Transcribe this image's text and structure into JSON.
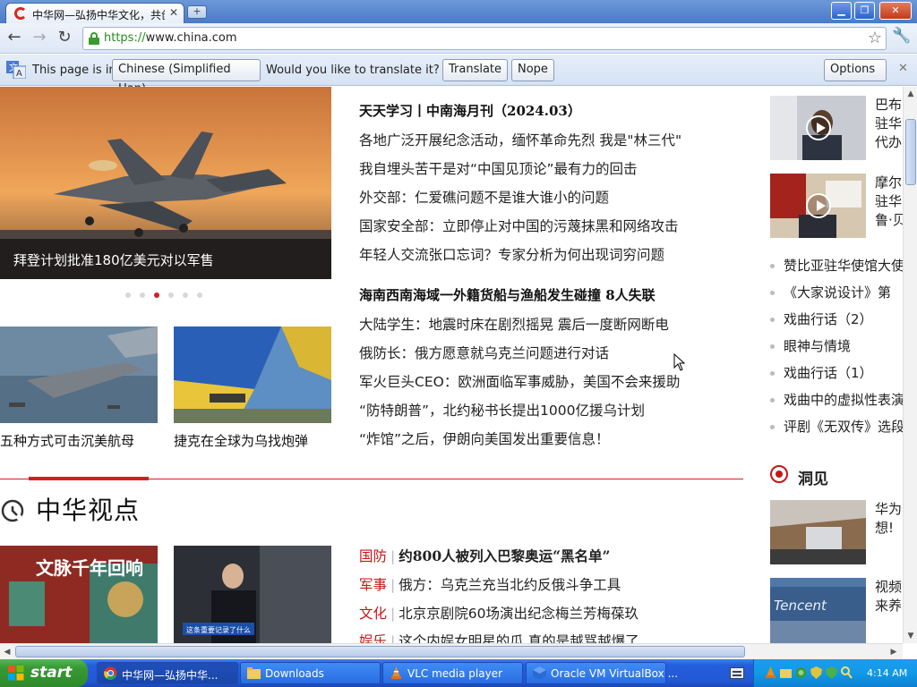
{
  "browser": {
    "tab_title": "中华网—弘扬中华文化，共创",
    "tab_close": "✕",
    "new_tab": "+",
    "url_scheme": "https://",
    "url_host": "www.china.com",
    "window_controls": {
      "minimize": "▁",
      "maximize": "❐",
      "close": "✕"
    }
  },
  "translate_bar": {
    "prefix": "This page is in",
    "language": "Chinese (Simplified Han)",
    "question": "Would you like to translate it?",
    "translate_label": "Translate",
    "nope_label": "Nope",
    "options_label": "Options",
    "close": "✕"
  },
  "page": {
    "hero": {
      "caption": "拜登计划批准180亿美元对以军售",
      "slide_count": 6,
      "active_slide": 3
    },
    "thumbs": [
      {
        "caption": "五种方式可击沉美航母"
      },
      {
        "caption": "捷克在全球为乌找炮弹"
      }
    ],
    "news_group1": {
      "headline": "天天学习丨中南海月刊（2024.03）",
      "items": [
        "各地广泛开展纪念活动，缅怀革命先烈 我是\"林三代\"",
        "我自埋头苦干是对“中国见顶论”最有力的回击",
        "外交部：仁爱礁问题不是谁大谁小的问题",
        "国家安全部：立即停止对中国的污蔑抹黑和网络攻击",
        "年轻人交流张口忘词？专家分析为何出现词穷问题"
      ]
    },
    "news_group2": {
      "headline": "海南西南海域一外籍货船与渔船发生碰撞 8人失联",
      "items": [
        "大陆学生：地震时床在剧烈摇晃 震后一度断网断电",
        "俄防长：俄方愿意就乌克兰问题进行对话",
        "军火巨头CEO：欧洲面临军事威胁，美国不会来援助",
        "“防特朗普”，北约秘书长提出1000亿援乌计划",
        "“炸馆”之后，伊朗向美国发出重要信息！"
      ]
    },
    "section": {
      "title": "中华视点",
      "items": [
        {
          "category": "国防",
          "text": "约800人被列入巴黎奥运“黑名单”",
          "bold": true
        },
        {
          "category": "军事",
          "text": "俄方：乌克兰充当北约反俄斗争工具",
          "bold": false
        },
        {
          "category": "文化",
          "text": "北京京剧院60场演出纪念梅兰芳梅葆玖",
          "bold": false
        },
        {
          "category": "娱乐",
          "text": "这个内娱女明星的瓜 真的是越骂越爆了",
          "bold": false
        }
      ],
      "thumb1_text": "文脉千年回响",
      "thumb2_badge": "这条重要记录了什么"
    },
    "right": {
      "videos": [
        {
          "lines": [
            "巴布",
            "驻华",
            "代办"
          ]
        },
        {
          "lines": [
            "摩尔",
            "驻华",
            "鲁·贝"
          ]
        }
      ],
      "list": [
        "赞比亚驻华使馆大使",
        "《大家说设计》第",
        "戏曲行话（2）",
        "眼神与情境",
        "戏曲行话（1）",
        "戏曲中的虚拟性表演",
        "评剧《无双传》选段"
      ],
      "insight_title": "洞见",
      "insights": [
        {
          "lines": [
            "华为",
            "想!"
          ]
        },
        {
          "lines": [
            "视频",
            "来养"
          ]
        }
      ]
    }
  },
  "taskbar": {
    "start_label": "start",
    "tasks": [
      {
        "label": "中华网—弘扬中华...",
        "icon": "chrome-icon"
      },
      {
        "label": "Downloads",
        "icon": "folder-icon"
      },
      {
        "label": "VLC media player",
        "icon": "vlc-icon"
      },
      {
        "label": "Oracle VM VirtualBox ...",
        "icon": "virtualbox-icon"
      }
    ],
    "clock": "4:14 AM"
  }
}
